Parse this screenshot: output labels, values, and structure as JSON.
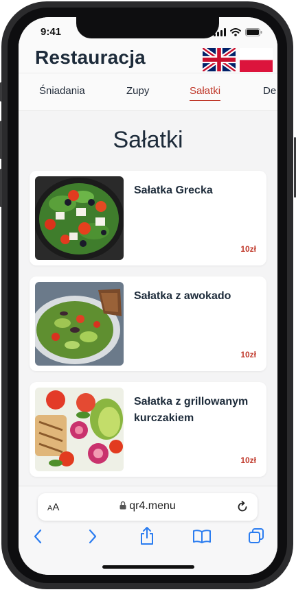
{
  "status_bar": {
    "time": "9:41"
  },
  "header": {
    "title": "Restauracja",
    "languages": [
      "English",
      "Polski"
    ]
  },
  "tabs": [
    {
      "label": "Śniadania",
      "active": false
    },
    {
      "label": "Zupy",
      "active": false
    },
    {
      "label": "Sałatki",
      "active": true
    },
    {
      "label": "De",
      "active": false
    }
  ],
  "section": {
    "title": "Sałatki"
  },
  "items": [
    {
      "name": "Sałatka Grecka",
      "price": "10zł"
    },
    {
      "name": "Sałatka z awokado",
      "price": "10zł"
    },
    {
      "name": "Sałatka z grillowanym kurczakiem",
      "price": "10zł"
    }
  ],
  "browser": {
    "text_size_label": "AA",
    "url": "qr4.menu"
  },
  "colors": {
    "accent": "#c0392b",
    "title": "#1d2b3a",
    "background": "#f4f4f5"
  }
}
